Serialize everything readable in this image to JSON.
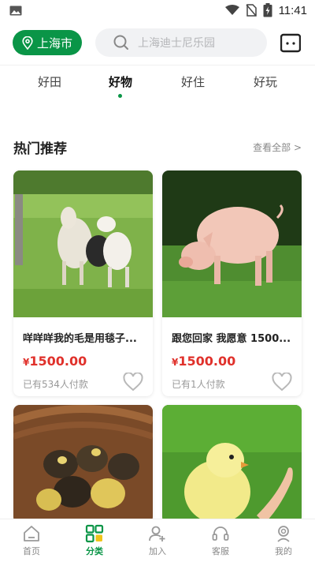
{
  "status_bar": {
    "time": "11:41"
  },
  "header": {
    "city": "上海市",
    "search_placeholder": "上海迪士尼乐园"
  },
  "tabs": [
    {
      "label": "好田",
      "active": false
    },
    {
      "label": "好物",
      "active": true
    },
    {
      "label": "好住",
      "active": false
    },
    {
      "label": "好玩",
      "active": false
    }
  ],
  "section": {
    "title": "热门推荐",
    "see_all": "查看全部 >"
  },
  "products": [
    {
      "name": "咩咩咩我的毛是用毯子...",
      "currency": "¥",
      "price": "1500.00",
      "sold": "已有534人付款",
      "image": "goats-on-grass"
    },
    {
      "name": "跟您回家 我愿意 1500...",
      "currency": "¥",
      "price": "1500.00",
      "sold": "已有1人付款",
      "image": "pig-grazing"
    },
    {
      "image": "ducklings-in-basket"
    },
    {
      "image": "chick-in-hand"
    }
  ],
  "bottom_nav": [
    {
      "label": "首页",
      "icon": "home-icon",
      "active": false
    },
    {
      "label": "分类",
      "icon": "category-icon",
      "active": true
    },
    {
      "label": "加入",
      "icon": "add-user-icon",
      "active": false
    },
    {
      "label": "客服",
      "icon": "headset-icon",
      "active": false
    },
    {
      "label": "我的",
      "icon": "profile-icon",
      "active": false
    }
  ],
  "colors": {
    "brand_green": "#0a9547",
    "price_red": "#e0312b"
  }
}
